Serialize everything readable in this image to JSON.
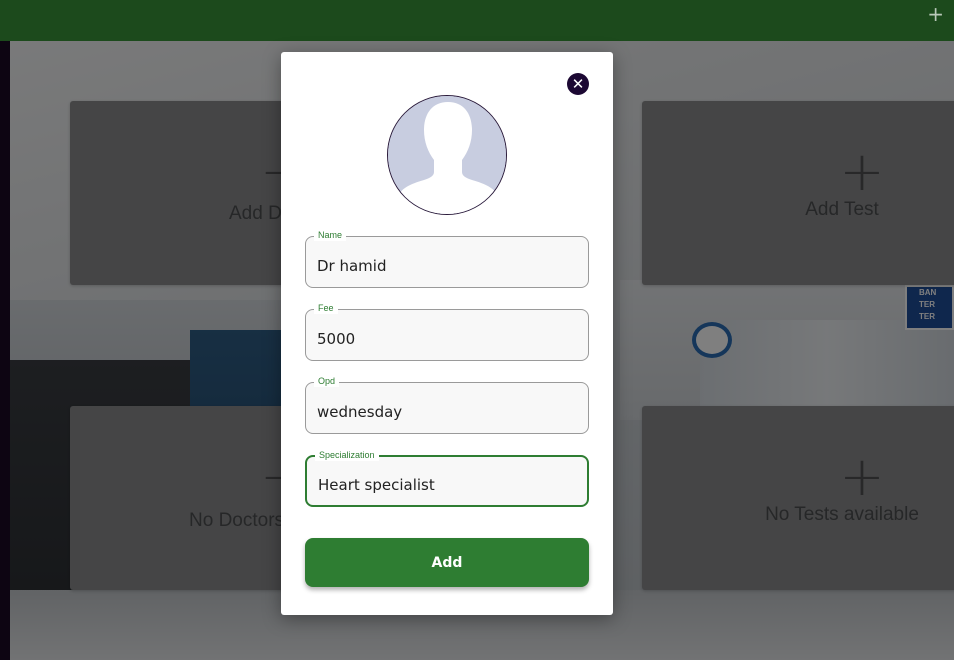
{
  "topbar": {
    "plus_icon": "+"
  },
  "cards": [
    {
      "label": "Add Doctor",
      "plus": "+"
    },
    {
      "label": "Add Test",
      "plus": "+"
    },
    {
      "label": "No Doctors available",
      "plus": "+"
    },
    {
      "label": "No Tests available",
      "plus": "+"
    }
  ],
  "background_sign": {
    "lines": [
      "BAN",
      "TER",
      "TER"
    ]
  },
  "modal": {
    "close_icon": "✕",
    "fields": {
      "name": {
        "label": "Name",
        "value": "Dr hamid"
      },
      "fee": {
        "label": "Fee",
        "value": "5000"
      },
      "opd": {
        "label": "Opd",
        "value": "wednesday"
      },
      "specialization": {
        "label": "Specialization",
        "value": "Heart specialist"
      }
    },
    "add_button": "Add"
  },
  "colors": {
    "topbar": "#1c4a1c",
    "accent_green": "#2e7d32",
    "close_button": "#1c0833",
    "avatar_bg": "#c8cde0"
  }
}
